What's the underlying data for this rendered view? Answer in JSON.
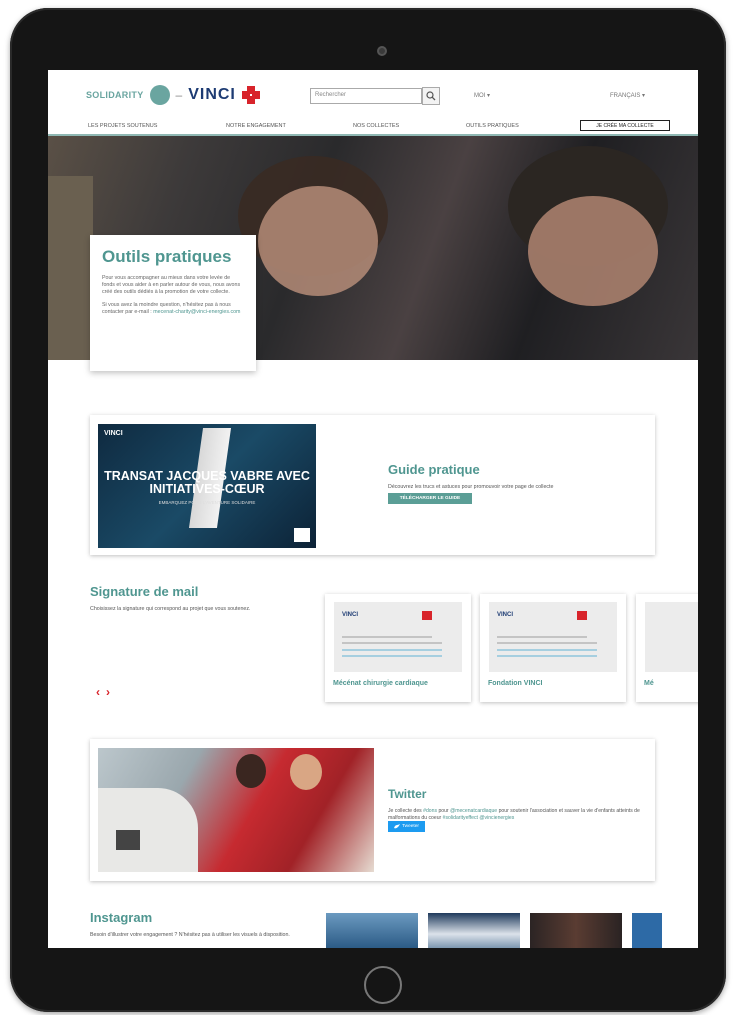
{
  "header": {
    "logo_solidarity": "SOLIDARITY",
    "logo_vinci": "VINCI",
    "search_placeholder": "Rechercher",
    "user_menu": "MOI ▾",
    "language": "FRANÇAIS ▾",
    "create_button": "JE CRÉE MA COLLECTE"
  },
  "nav": [
    {
      "label": "LES PROJETS SOUTENUS"
    },
    {
      "label": "NOTRE ENGAGEMENT"
    },
    {
      "label": "NOS COLLECTES"
    },
    {
      "label": "OUTILS PRATIQUES"
    }
  ],
  "hero": {
    "title": "Outils pratiques",
    "paragraph1": "Pour vous accompagner au mieux dans votre levée de fonds et vous aider à en parler autour de vous, nous avons créé des outils dédiés à la promotion de votre collecte.",
    "paragraph2": "Si vous avez la moindre question, n'hésitez pas à nous contacter par e-mail :",
    "email": "mecenat-charity@vinci-energies.com"
  },
  "guide": {
    "image_brand": "VINCI",
    "image_title": "TRANSAT JACQUES VABRE AVEC INITIATIVES-CŒUR",
    "image_subtitle": "EMBARQUEZ POUR L'AVENTURE SOLIDAIRE",
    "title": "Guide pratique",
    "description": "Découvrez les trucs et astuces pour promouvoir votre page de collecte",
    "button": "TÉLÉCHARGER LE GUIDE"
  },
  "signature": {
    "title": "Signature de mail",
    "description": "Choisissez la signature qui correspond au projet que vous soutenez.",
    "prev": "‹",
    "next": "›",
    "cards": [
      {
        "name": "Mécénat chirurgie cardiaque"
      },
      {
        "name": "Fondation VINCI"
      },
      {
        "name": "Mé"
      }
    ]
  },
  "twitter": {
    "title": "Twitter",
    "text_a": "Je collecte des",
    "hashtag_dons": "#dons",
    "text_b": "pour",
    "handle": "@mecenatcardiaque",
    "text_c": "pour soutenir l'association et sauver la vie d'enfants atteints de malformations du coeur",
    "tags": "#solidarityeffect @vincienergies",
    "button": "Tweeter"
  },
  "instagram": {
    "title": "Instagram",
    "description": "Besoin d'illustrer votre engagement ? N'hésitez pas à utiliser les visuels à disposition."
  },
  "colors": {
    "brand_teal": "#4f9690",
    "vinci_red": "#d8242b",
    "vinci_blue": "#1d3b73",
    "twitter_blue": "#1d9bf0"
  }
}
